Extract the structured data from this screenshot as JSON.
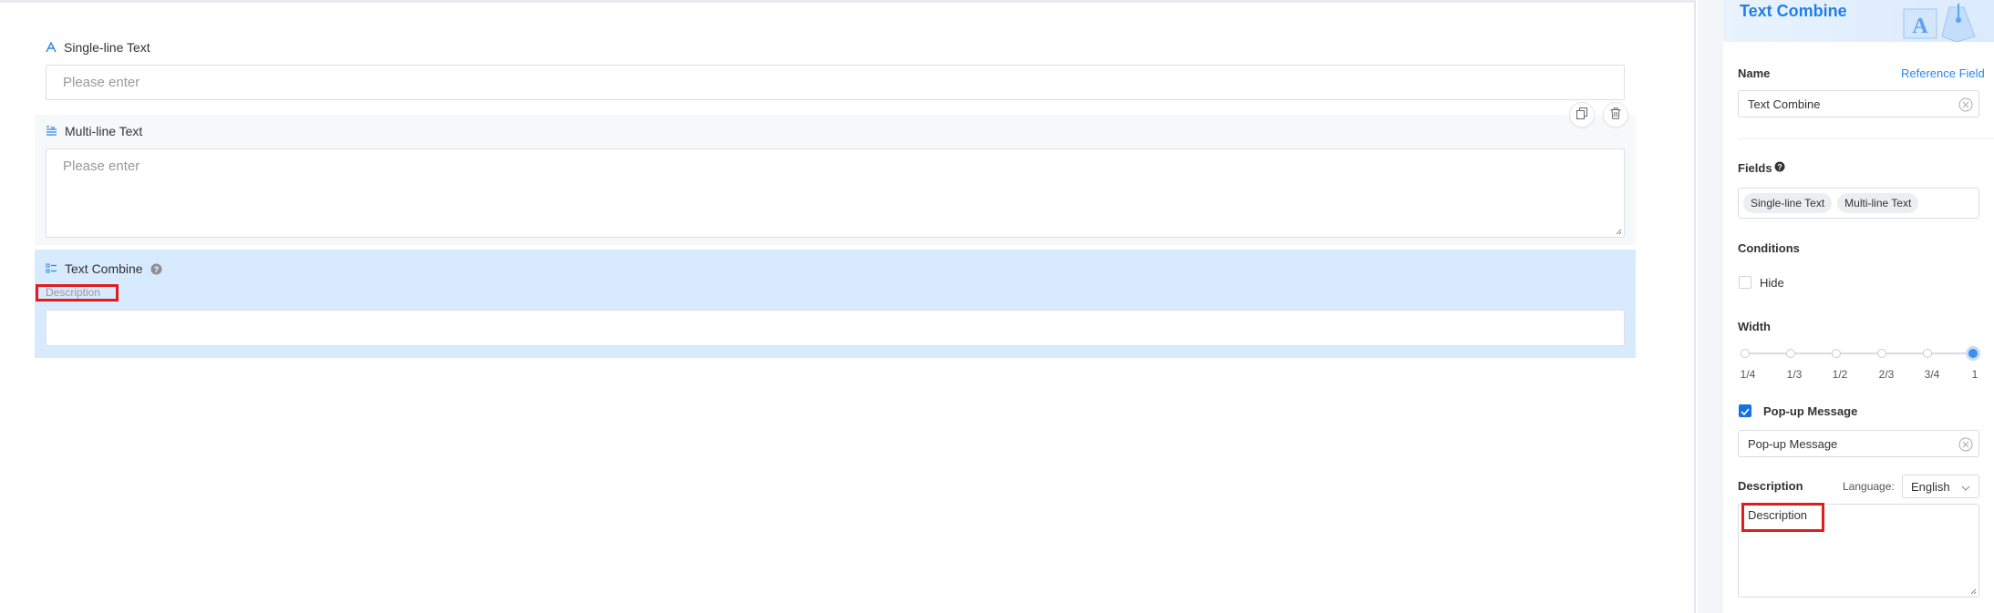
{
  "form": {
    "single_line": {
      "label": "Single-line Text",
      "placeholder": "Please enter"
    },
    "multi_line": {
      "label": "Multi-line Text",
      "placeholder": "Please enter"
    },
    "text_combine": {
      "label": "Text Combine",
      "description": "Description"
    }
  },
  "panel": {
    "title": "Text Combine",
    "name_label": "Name",
    "reference_field": "Reference Field",
    "name_value": "Text Combine",
    "fields_label": "Fields",
    "fields": [
      "Single-line Text",
      "Multi-line Text"
    ],
    "conditions_label": "Conditions",
    "hide_label": "Hide",
    "width_label": "Width",
    "width_ticks": [
      "1/4",
      "1/3",
      "1/2",
      "2/3",
      "3/4",
      "1"
    ],
    "width_selected": "1",
    "popup_label": "Pop-up Message",
    "popup_value": "Pop-up Message",
    "description_label": "Description",
    "language_label": "Language:",
    "language_value": "English",
    "description_value": "Description"
  },
  "colors": {
    "accent": "#1f7fe6",
    "selected_bg": "#d7eafe",
    "highlight": "#e21b1b"
  },
  "icons": [
    "text-icon",
    "multiline-icon",
    "combine-icon",
    "help-icon",
    "copy-icon",
    "trash-icon",
    "clear-icon",
    "chevron-down-icon",
    "check-icon"
  ]
}
